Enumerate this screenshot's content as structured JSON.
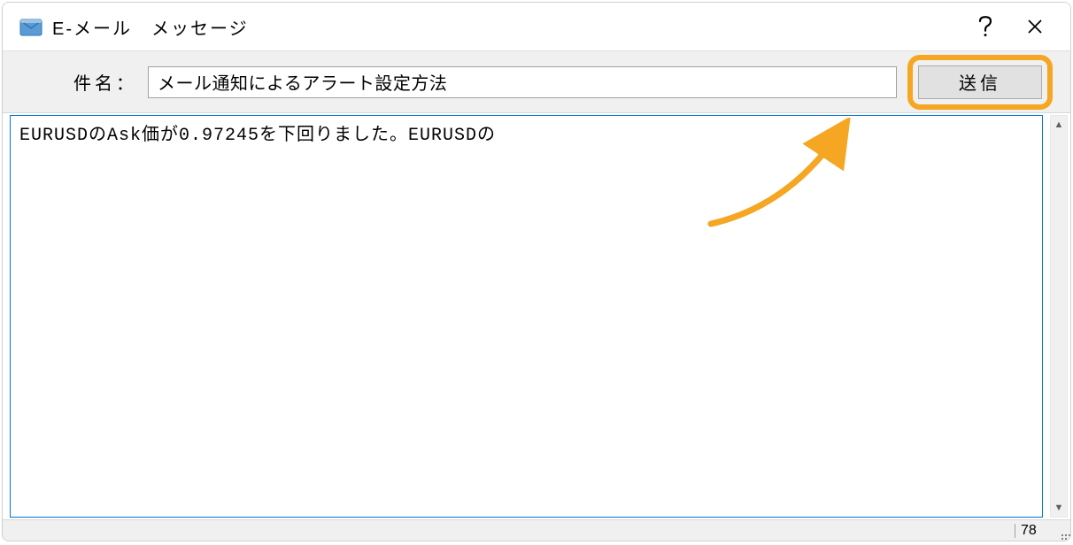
{
  "window": {
    "title": "E-メール　メッセージ"
  },
  "toolbar": {
    "subject_label": "件名：",
    "subject_value": "メール通知によるアラート設定方法",
    "send_label": "送信"
  },
  "body": {
    "text": "EURUSDのAsk価が0.97245を下回りました。EURUSDの"
  },
  "statusbar": {
    "char_count": "78"
  },
  "annotation": {
    "highlight_color": "#F5A623"
  }
}
